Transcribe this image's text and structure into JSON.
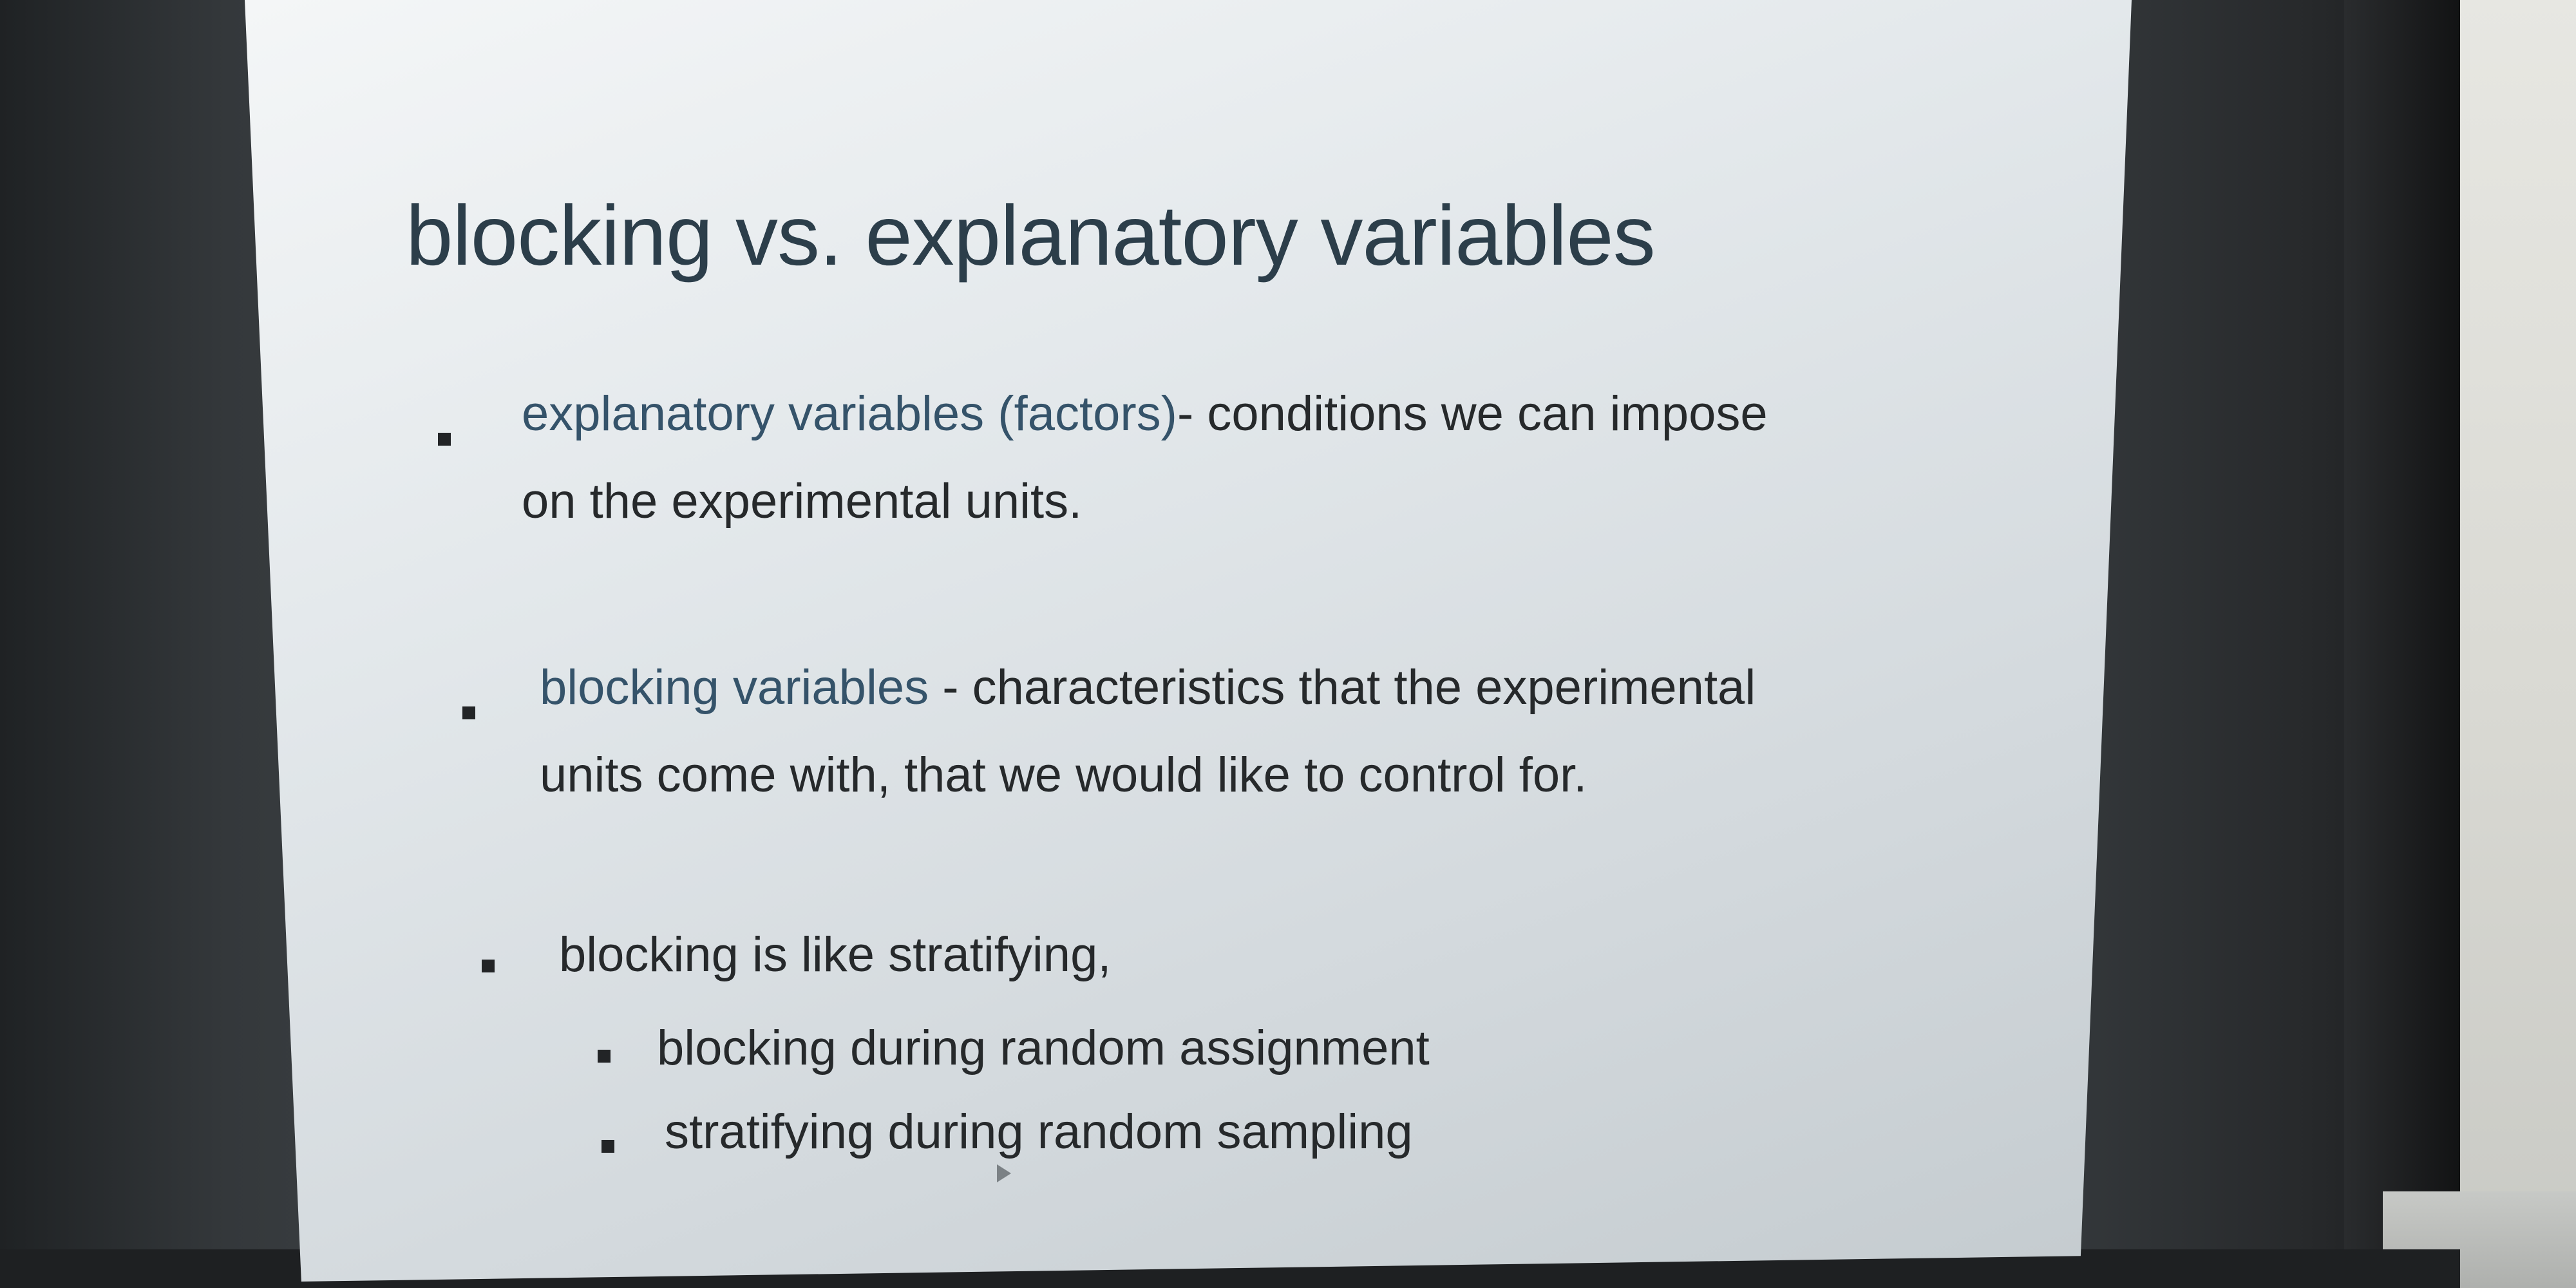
{
  "slide": {
    "title": "blocking vs. explanatory variables",
    "bullets": [
      {
        "term": "explanatory variables (factors)",
        "rest_line1": "- conditions we can impose",
        "line2": "on the experimental units."
      },
      {
        "term": "blocking variables",
        "rest_line1": " - characteristics that the experimental",
        "line2": "units come with, that we would like to control for."
      },
      {
        "text": "blocking is like stratifying,",
        "sub_bullets": [
          "blocking during random assignment",
          "stratifying during random sampling"
        ]
      }
    ]
  },
  "icons": {
    "bullet": "square-bullet-icon",
    "cursor": "mouse-cursor-icon"
  },
  "colors": {
    "title": "#2c3e4a",
    "term": "#35536a",
    "body": "#26292b",
    "slide_bg": "#e3e8eb",
    "bezel": "#2b2d2f"
  }
}
